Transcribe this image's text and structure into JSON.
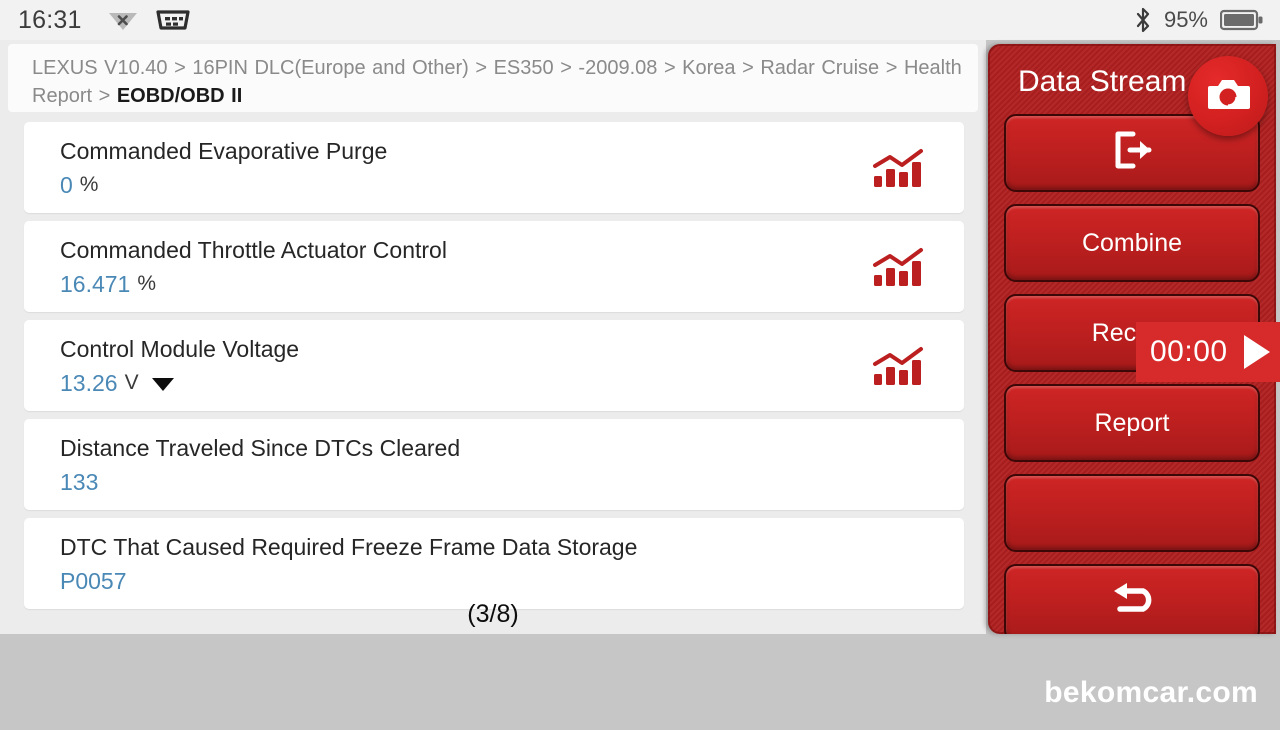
{
  "statusbar": {
    "time": "16:31",
    "battery_percent": "95%",
    "icons": {
      "wifi": "wifi-off-icon",
      "connector": "obd-connector-icon",
      "bluetooth": "bluetooth-icon",
      "battery": "battery-icon"
    }
  },
  "breadcrumb": {
    "path": "LEXUS V10.40 > 16PIN DLC(Europe and Other) > ES350 > -2009.08 > Korea > Radar Cruise > Health Report > ",
    "current": "EOBD/OBD II"
  },
  "list": {
    "page_indicator": "(3/8)",
    "rows": [
      {
        "name": "Commanded Evaporative Purge",
        "value": "0",
        "unit": "%",
        "has_chart_icon": true,
        "has_dropdown": false
      },
      {
        "name": "Commanded Throttle Actuator Control",
        "value": "16.471",
        "unit": "%",
        "has_chart_icon": true,
        "has_dropdown": false
      },
      {
        "name": "Control Module Voltage",
        "value": "13.26",
        "unit": "V",
        "has_chart_icon": true,
        "has_dropdown": true
      },
      {
        "name": "Distance Traveled Since DTCs Cleared",
        "value": "133",
        "unit": "",
        "has_chart_icon": false,
        "has_dropdown": false
      },
      {
        "name": "DTC That Caused Required Freeze Frame Data Storage",
        "value": "P0057",
        "unit": "",
        "has_chart_icon": false,
        "has_dropdown": false
      }
    ]
  },
  "panel": {
    "title": "Data Stream",
    "buttons": [
      {
        "label": "",
        "icon": "exit-icon"
      },
      {
        "label": "Combine",
        "icon": ""
      },
      {
        "label": "Record",
        "icon": ""
      },
      {
        "label": "Report",
        "icon": ""
      },
      {
        "label": "",
        "icon": ""
      },
      {
        "label": "",
        "icon": "back-arrow-icon"
      }
    ],
    "camera_icon": "camera-icon",
    "timer": {
      "value": "00:00",
      "play_icon": "play-icon"
    }
  },
  "footer": {
    "watermark": "bekomcar.com"
  },
  "colors": {
    "panel_red": "#b01f1f",
    "button_red": "#c02020",
    "value_blue": "#4a88b6",
    "timer_red": "#d72a2a",
    "chart_icon_red": "#bc1f1f"
  }
}
